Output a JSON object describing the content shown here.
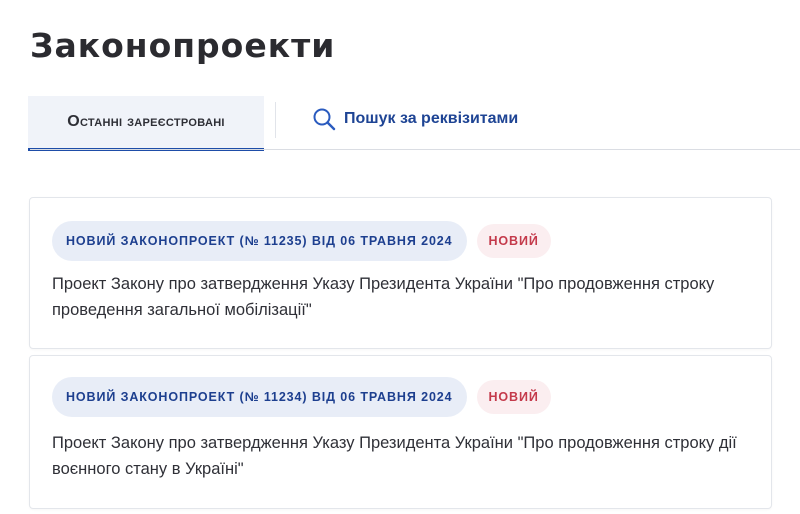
{
  "page": {
    "title": "Законопроекти"
  },
  "tabs": {
    "active_label": "Останні зареєстровані",
    "search_label": "Пошук за реквізитами",
    "search_icon": "search-icon"
  },
  "bills": [
    {
      "badge": "НОВИЙ ЗАКОНОПРОЕКТ (№ 11235) ВІД 06 ТРАВНЯ 2024",
      "status": "НОВИЙ",
      "title": "Проект Закону про затвердження Указу Президента України \"Про продовження строку проведення загальної мобілізації\""
    },
    {
      "badge": "НОВИЙ ЗАКОНОПРОЕКТ (№ 11234) ВІД 06 ТРАВНЯ 2024",
      "status": "НОВИЙ",
      "title": "Проект Закону про затвердження Указу Президента України \"Про продовження строку дії воєнного стану в Україні\""
    }
  ],
  "colors": {
    "accent": "#1e4da8",
    "badge_bg": "#e8edf7",
    "badge_text": "#1d3f8f",
    "status_bg": "#fbeef0",
    "status_text": "#c43a4b"
  }
}
